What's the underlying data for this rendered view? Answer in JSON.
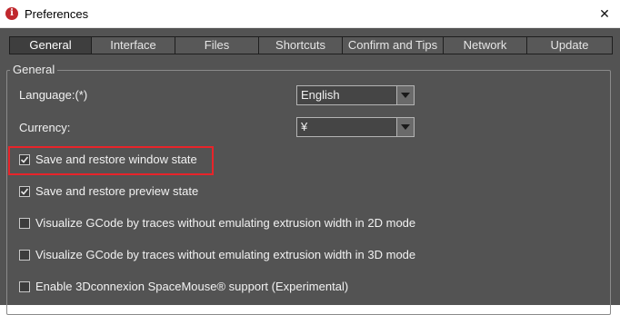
{
  "window": {
    "title": "Preferences",
    "app_icon_glyph": "i",
    "close_glyph": "✕"
  },
  "tabs": [
    {
      "label": "General",
      "active": true
    },
    {
      "label": "Interface",
      "active": false
    },
    {
      "label": "Files",
      "active": false
    },
    {
      "label": "Shortcuts",
      "active": false
    },
    {
      "label": "Confirm and Tips",
      "active": false
    },
    {
      "label": "Network",
      "active": false
    },
    {
      "label": "Update",
      "active": false
    }
  ],
  "general": {
    "group_title": "General",
    "language": {
      "label": "Language:(*)",
      "value": "English"
    },
    "currency": {
      "label": "Currency:",
      "value": "¥"
    },
    "options": [
      {
        "label": "Save and restore window state",
        "checked": true,
        "highlighted": true
      },
      {
        "label": "Save and restore preview state",
        "checked": true,
        "highlighted": false
      },
      {
        "label": "Visualize GCode by traces without emulating extrusion width in 2D mode",
        "checked": false,
        "highlighted": false
      },
      {
        "label": "Visualize GCode by traces without emulating extrusion width in 3D mode",
        "checked": false,
        "highlighted": false
      },
      {
        "label": "Enable 3Dconnexion SpaceMouse® support (Experimental)",
        "checked": false,
        "highlighted": false
      }
    ]
  },
  "colors": {
    "panel_bg": "#535353",
    "highlight_border": "#e8242a",
    "app_icon": "#c0282d"
  }
}
